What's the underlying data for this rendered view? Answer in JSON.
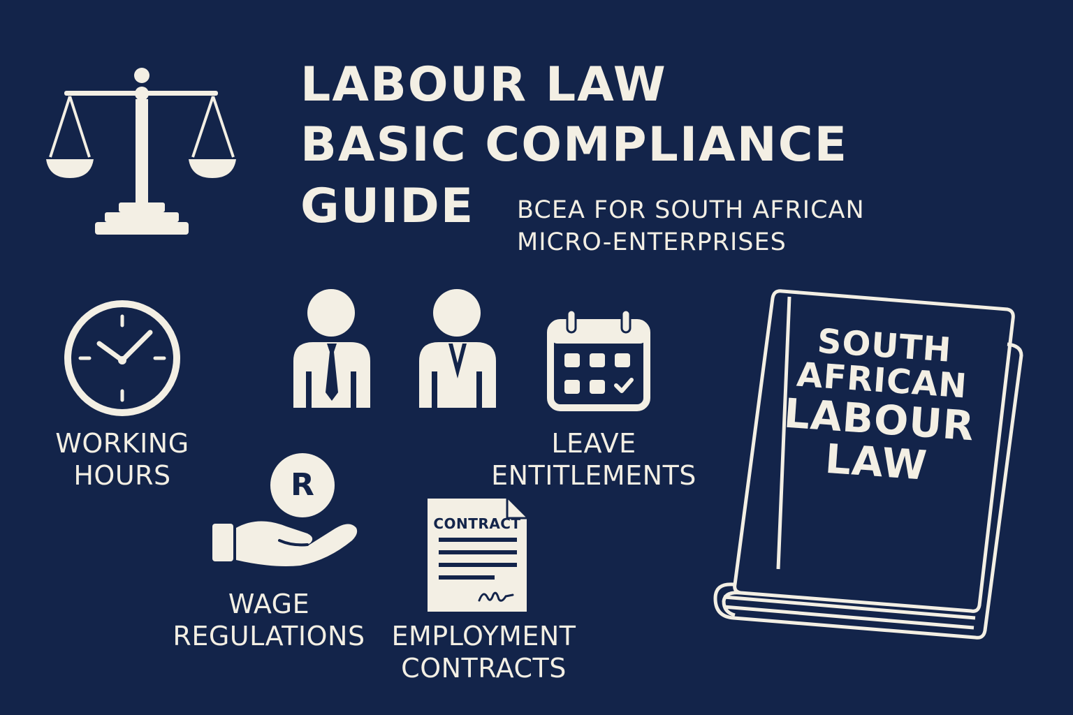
{
  "title": {
    "line1": "LABOUR LAW",
    "line2": "BASIC COMPLIANCE",
    "line3": "GUIDE"
  },
  "subtitle": {
    "line1": "BCEA FOR SOUTH AFRICAN",
    "line2": "MICRO-ENTERPRISES"
  },
  "topics": {
    "working_hours": {
      "line1": "WORKING",
      "line2": "HOURS"
    },
    "leave": {
      "line1": "LEAVE",
      "line2": "ENTITLEMENTS"
    },
    "wage": {
      "line1": "WAGE",
      "line2": "REGULATIONS",
      "coin_symbol": "R"
    },
    "contracts": {
      "line1": "EMPLOYMENT",
      "line2": "CONTRACTS",
      "doc_label": "CONTRACT"
    }
  },
  "book": {
    "line1": "SOUTH",
    "line2": "AFRICAN",
    "line3": "LABOUR",
    "line4": "LAW"
  },
  "colors": {
    "background": "#13244a",
    "foreground": "#f3efe4"
  }
}
